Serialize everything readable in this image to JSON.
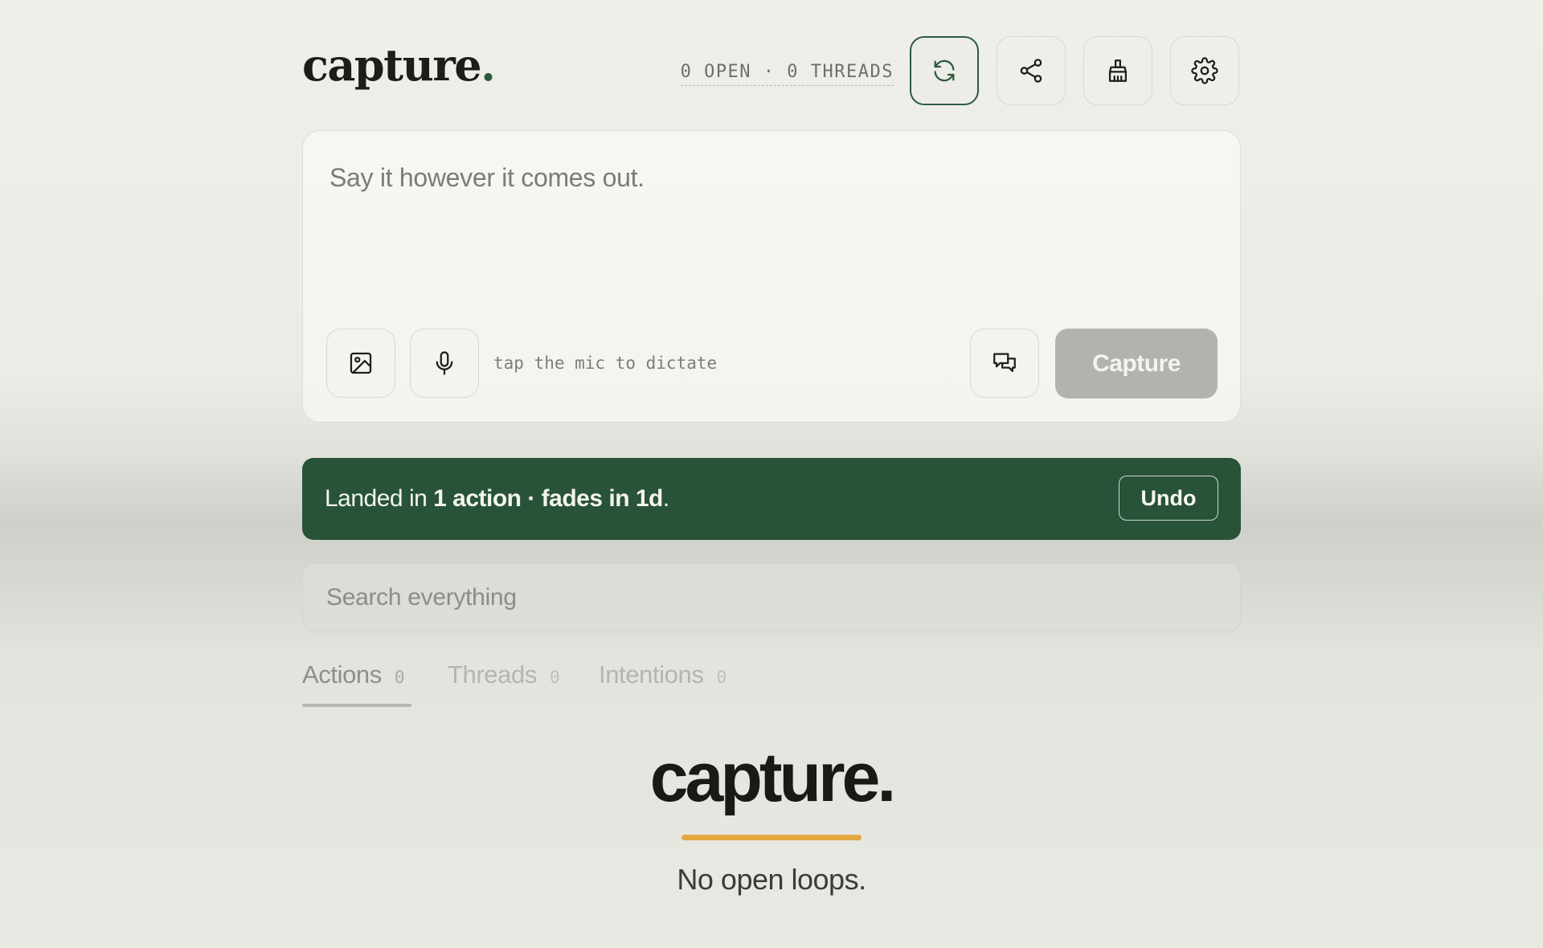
{
  "header": {
    "logo_text": "capture",
    "logo_dot": ".",
    "counter": "0 OPEN · 0 THREADS",
    "buttons": {
      "sync_icon": "sync-icon",
      "share_icon": "share-icon",
      "clear_icon": "broom-icon",
      "settings_icon": "gear-icon"
    }
  },
  "composer": {
    "placeholder": "Say it however it comes out.",
    "dictate_hint": "tap the mic to dictate",
    "capture_label": "Capture",
    "image_icon": "image-icon",
    "mic_icon": "microphone-icon",
    "chat_icon": "chat-bubbles-icon"
  },
  "toast": {
    "prefix": "Landed in ",
    "bold": "1 action · fades in 1d",
    "suffix": ".",
    "undo_label": "Undo"
  },
  "search": {
    "placeholder": "Search everything"
  },
  "tabs": [
    {
      "label": "Actions",
      "count": "0",
      "active": true
    },
    {
      "label": "Threads",
      "count": "0",
      "active": false
    },
    {
      "label": "Intentions",
      "count": "0",
      "active": false
    }
  ],
  "empty_state": {
    "logo": "capture.",
    "message": "No open loops."
  },
  "colors": {
    "accent_green": "#295338",
    "amber": "#e3a93f",
    "capture_disabled": "#b2b3ae"
  }
}
